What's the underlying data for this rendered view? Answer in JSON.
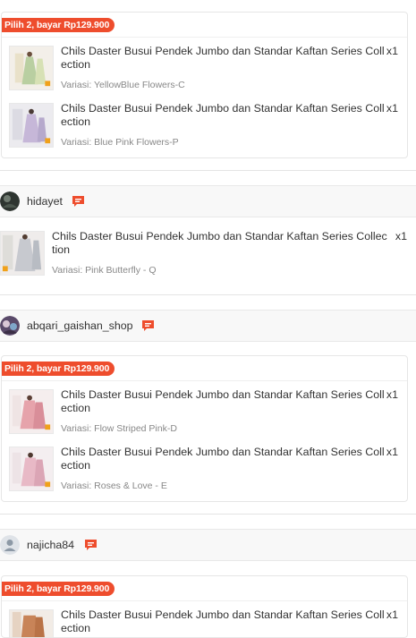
{
  "colors": {
    "accent": "#ee4d2d",
    "text": "#333333",
    "muted": "#888888"
  },
  "groups": [
    {
      "bundle_label": "Pilih 2, bayar Rp129.900",
      "products": [
        {
          "title": "Chils Daster Busui Pendek Jumbo dan Standar Kaftan Series Collection",
          "qty": "x1",
          "variant": "Variasi: YellowBlue Flowers-C"
        },
        {
          "title": "Chils Daster Busui Pendek Jumbo dan Standar Kaftan Series Collection",
          "qty": "x1",
          "variant": "Variasi: Blue Pink Flowers-P"
        }
      ]
    },
    {
      "shop": {
        "name": "hidayet",
        "avatar_icon": "dark-avatar-icon",
        "chat_icon": "chat-icon"
      },
      "products": [
        {
          "title": "Chils Daster Busui Pendek Jumbo dan Standar Kaftan Series Collection",
          "qty": "x1",
          "variant": "Variasi: Pink Butterfly - Q"
        }
      ]
    },
    {
      "shop": {
        "name": "abqari_gaishan_shop",
        "avatar_icon": "photo-avatar-icon",
        "chat_icon": "chat-icon"
      },
      "bundle_label": "Pilih 2, bayar Rp129.900",
      "products": [
        {
          "title": "Chils Daster Busui Pendek Jumbo dan Standar Kaftan Series Collection",
          "qty": "x1",
          "variant": "Variasi: Flow Striped Pink-D"
        },
        {
          "title": "Chils Daster Busui Pendek Jumbo dan Standar Kaftan Series Collection",
          "qty": "x1",
          "variant": "Variasi: Roses & Love - E"
        }
      ]
    },
    {
      "shop": {
        "name": "najicha84",
        "avatar_icon": "default-user-avatar-icon",
        "chat_icon": "chat-icon"
      },
      "bundle_label": "Pilih 2, bayar Rp129.900",
      "products": [
        {
          "title": "Chils Daster Busui Pendek Jumbo dan Standar Kaftan Series Collection",
          "qty": "x1",
          "variant": ""
        }
      ]
    }
  ]
}
